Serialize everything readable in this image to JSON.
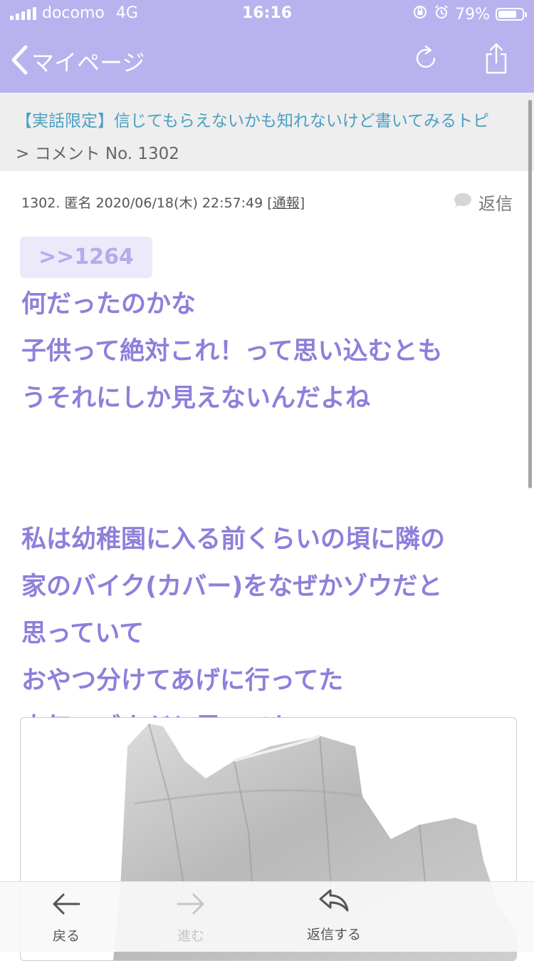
{
  "status_bar": {
    "carrier": "docomo",
    "network": "4G",
    "time": "16:16",
    "battery_percent": "79%",
    "battery_level": 0.79
  },
  "nav": {
    "back_label": "マイページ",
    "icons": [
      "reload-icon",
      "share-icon"
    ]
  },
  "breadcrumb": {
    "topic_link": "【実話限定】信じてもらえないかも知れないけど書いてみるトピ",
    "sub": "> コメント No. 1302"
  },
  "post": {
    "number": "1302.",
    "author": "匿名",
    "datetime": "2020/06/18(木) 22:57:49",
    "report_open": "[",
    "report_label": "通報",
    "report_close": "]",
    "reply_label": "返信",
    "anchor": ">>1264",
    "lines": [
      "何だったのかな",
      "子供って絶対これ！って思い込むとも",
      "うそれにしか見えないんだよね",
      "",
      "私は幼稚園に入る前くらいの頃に隣の",
      "家のバイク(カバー)をなぜかゾウだと",
      "思っていて",
      "おやつ分けてあげに行ってた",
      "本気でゾウだと思ってた"
    ],
    "accent_color": "#8e7fdb"
  },
  "toolbar": {
    "back_label": "戻る",
    "forward_label": "進む",
    "reply_label": "返信する"
  },
  "colors": {
    "header": "#b8b2ee",
    "link": "#4aa0c0"
  }
}
